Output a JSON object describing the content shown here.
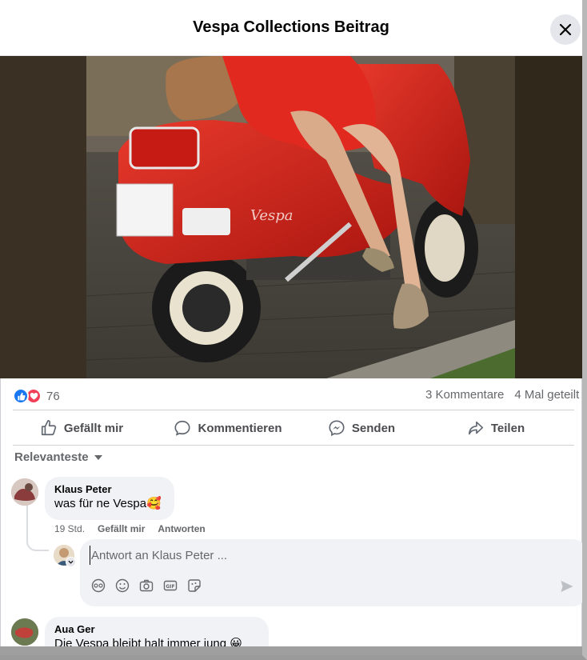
{
  "header": {
    "title": "Vespa Collections Beitrag",
    "close_icon": "close-icon"
  },
  "post": {
    "image_icon": "photo-vespa",
    "reactions": {
      "icons": [
        "like-icon",
        "love-icon"
      ],
      "count": "76"
    },
    "comments_count": "3 Kommentare",
    "shares_count": "4 Mal geteilt"
  },
  "actions": [
    {
      "label": "Gefällt mir",
      "icon": "thumbs-up-icon"
    },
    {
      "label": "Kommentieren",
      "icon": "comment-icon"
    },
    {
      "label": "Senden",
      "icon": "messenger-icon"
    },
    {
      "label": "Teilen",
      "icon": "share-icon"
    }
  ],
  "sort": {
    "label": "Relevanteste",
    "icon": "caret-down-icon"
  },
  "comments": [
    {
      "author": "Klaus Peter",
      "text": "was für ne Vespa🥰",
      "time": "19 Std.",
      "like_label": "Gefällt mir",
      "reply_label": "Antworten"
    },
    {
      "author": "Aua Ger",
      "text": "Die Vespa bleibt halt immer jung 😀"
    }
  ],
  "reply": {
    "placeholder": "Antwort an Klaus Peter ...",
    "tools": [
      "avatar-sticker-icon",
      "emoji-icon",
      "camera-icon",
      "gif-icon",
      "sticker-icon"
    ],
    "send_icon": "send-icon"
  },
  "colors": {
    "accent": "#1877f2",
    "love": "#f33e58",
    "scooter": "#d9261c",
    "bubble": "#f0f2f5",
    "muted_text": "#65676b"
  }
}
